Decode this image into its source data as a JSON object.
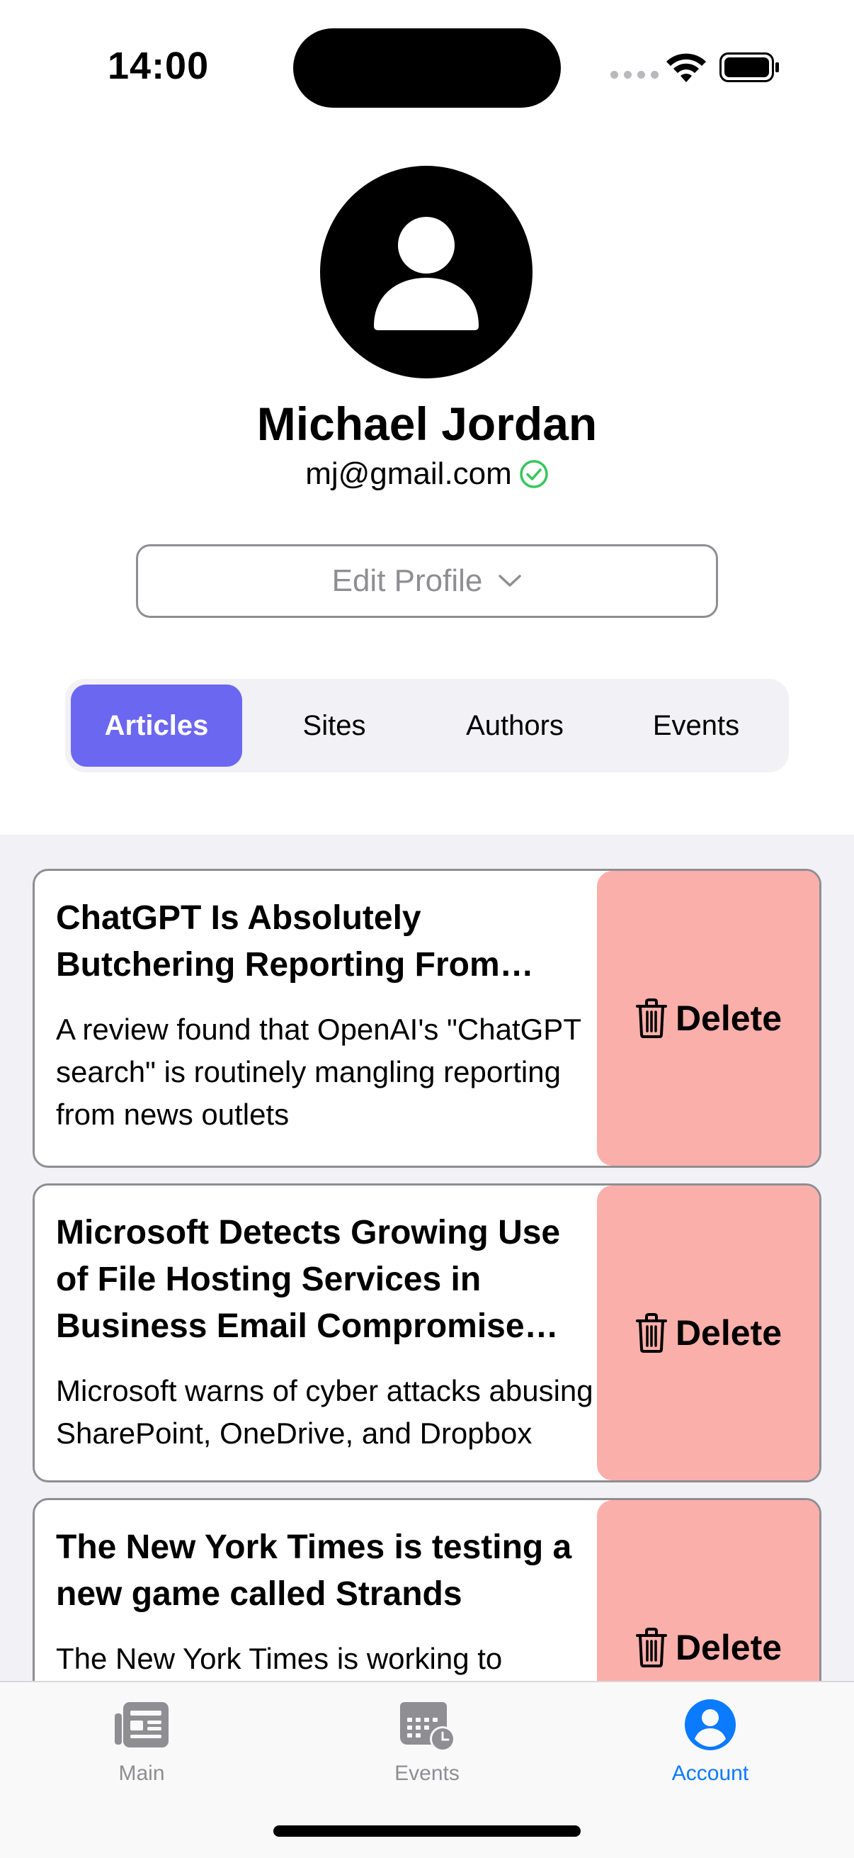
{
  "status_bar": {
    "time": "14:00"
  },
  "profile": {
    "name": "Michael Jordan",
    "email": "mj@gmail.com",
    "edit_button_label": "Edit Profile"
  },
  "segments": [
    {
      "label": "Articles",
      "selected": true
    },
    {
      "label": "Sites",
      "selected": false
    },
    {
      "label": "Authors",
      "selected": false
    },
    {
      "label": "Events",
      "selected": false
    }
  ],
  "articles": [
    {
      "title": "ChatGPT Is Absolutely Butchering Reporting From News Outlets",
      "summary": "A review found that OpenAI's \"ChatGPT search\" is routinely mangling reporting from news outlets",
      "delete_label": "Delete"
    },
    {
      "title": "Microsoft Detects Growing Use of File Hosting Services in Business Email Compromise Attacks",
      "summary": "Microsoft warns of cyber attacks abusing SharePoint, OneDrive, and Dropbox",
      "delete_label": "Delete"
    },
    {
      "title": "The New York Times is testing a new game called Strands",
      "summary": "The New York Times is working to",
      "delete_label": "Delete"
    }
  ],
  "tab_bar": {
    "items": [
      {
        "label": "Main",
        "icon": "newspaper-icon",
        "active": false
      },
      {
        "label": "Events",
        "icon": "calendar-clock-icon",
        "active": false
      },
      {
        "label": "Account",
        "icon": "person-circle-icon",
        "active": true
      }
    ]
  },
  "colors": {
    "accent": "#6c67f0",
    "delete_bg": "#fbafaa",
    "tab_active": "#0a7aff",
    "verified": "#34c759"
  }
}
